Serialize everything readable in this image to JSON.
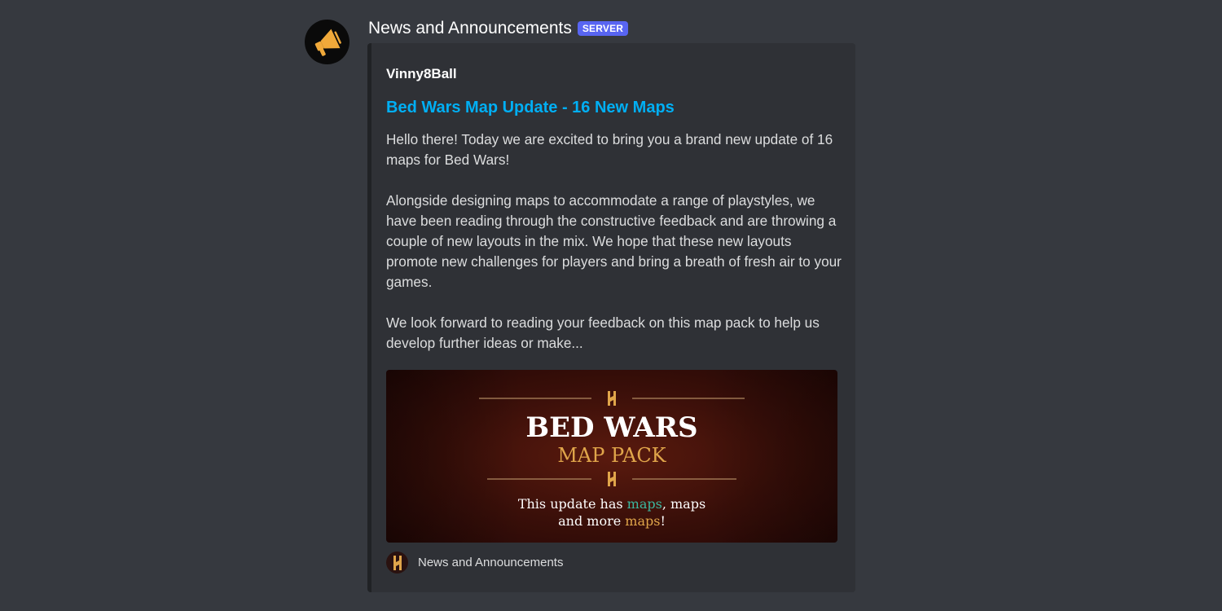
{
  "message": {
    "author": "News and Announcements",
    "badge": "SERVER",
    "avatar_icon": "megaphone-icon"
  },
  "embed": {
    "author": "Vinny8Ball",
    "title": "Bed Wars Map Update - 16 New Maps",
    "description": [
      "Hello there! Today we are excited to bring you a brand new update of 16 maps for Bed Wars!",
      "Alongside designing maps to accommodate a range of playstyles, we have been reading through the constructive feedback and are throwing a couple of new layouts in the mix. We hope that these new layouts promote new challenges for players and bring a breath of fresh air to your games.",
      "We look forward to reading your feedback on this map pack to help us develop further ideas or make..."
    ],
    "image": {
      "title": "BED WARS",
      "subtitle": "MAP PACK",
      "line1_prefix": "This update has ",
      "line1_highlight": "maps",
      "line1_suffix": ", maps",
      "line2_prefix": "and more ",
      "line2_highlight": "maps",
      "line2_suffix": "!"
    },
    "footer": {
      "text": "News and Announcements",
      "icon": "hypixel-logo-icon"
    }
  },
  "colors": {
    "background": "#36393f",
    "embed_bg": "#2f3136",
    "link": "#00aff4",
    "badge": "#5865f2",
    "megaphone": "#f0a93a",
    "gold": "#e0a54a",
    "teal": "#3bb8a0"
  }
}
